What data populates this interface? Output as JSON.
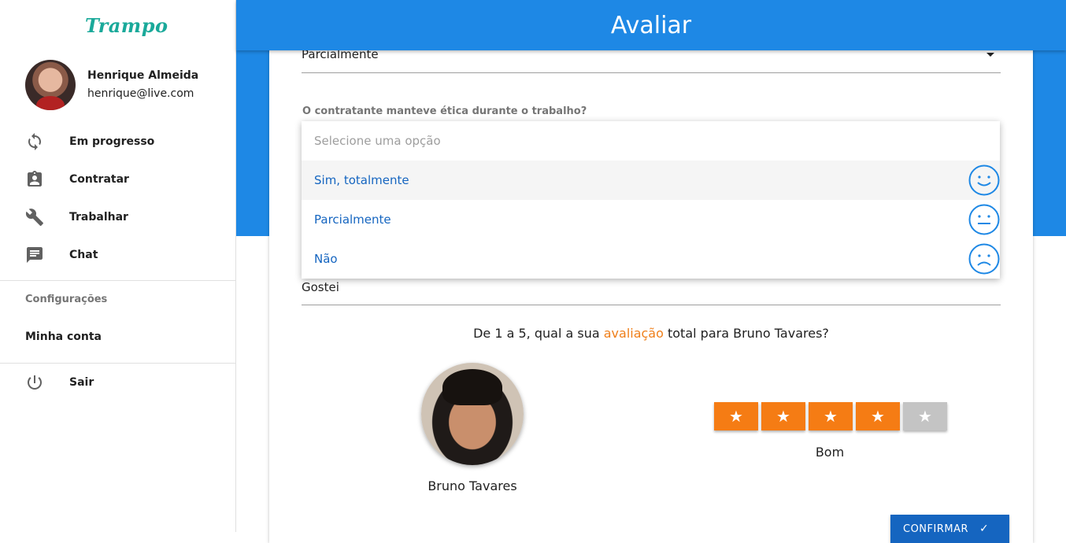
{
  "app": {
    "logo": "Trampo"
  },
  "user": {
    "name": "Henrique Almeida",
    "email": "henrique@live.com"
  },
  "nav": [
    {
      "label": "Em progresso",
      "icon": "sync-icon"
    },
    {
      "label": "Contratar",
      "icon": "assignment-ind-icon"
    },
    {
      "label": "Trabalhar",
      "icon": "wrench-icon"
    },
    {
      "label": "Chat",
      "icon": "chat-icon"
    }
  ],
  "settings": {
    "section_title": "Configurações",
    "account_label": "Minha conta"
  },
  "logout": {
    "label": "Sair",
    "icon": "power-icon"
  },
  "header": {
    "title": "Avaliar"
  },
  "form": {
    "previous_answer": "Parcialmente",
    "ethics_question": "O contratante manteve ética durante o trabalho?",
    "comment_value": "Gostei"
  },
  "dropdown": {
    "placeholder": "Selecione uma opção",
    "options": [
      {
        "label": "Sim, totalmente",
        "icon": "smile-face-icon"
      },
      {
        "label": "Parcialmente",
        "icon": "neutral-face-icon"
      },
      {
        "label": "Não",
        "icon": "sad-face-icon"
      }
    ]
  },
  "rating": {
    "question_prefix": "De 1 a 5, qual a sua ",
    "question_highlight": "avaliação",
    "question_suffix": " total para Bruno Tavares?",
    "person_name": "Bruno Tavares",
    "stars_value": 4,
    "stars_max": 5,
    "word": "Bom"
  },
  "actions": {
    "confirm_label": "CONFIRMAR"
  },
  "colors": {
    "primary": "#1e88e5",
    "accent": "#f57c14",
    "teal": "#1aa99a",
    "button": "#1565c0"
  }
}
